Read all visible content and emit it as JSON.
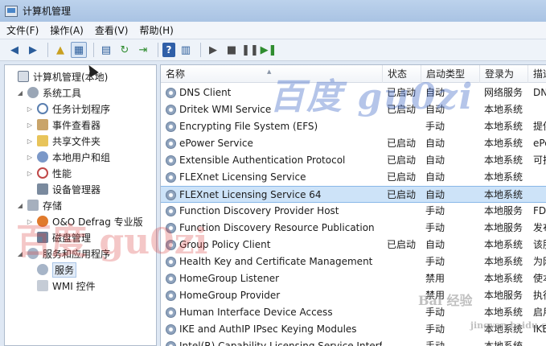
{
  "window": {
    "title": "计算机管理"
  },
  "menu": [
    "文件(F)",
    "操作(A)",
    "查看(V)",
    "帮助(H)"
  ],
  "toolbar": {
    "help_label": "?"
  },
  "tree": [
    {
      "label": "计算机管理(本地)",
      "icon": "computer-icon",
      "level": 0,
      "arrow": ""
    },
    {
      "label": "系统工具",
      "icon": "tools-icon",
      "level": 1,
      "arrow": "◢"
    },
    {
      "label": "任务计划程序",
      "icon": "clock-icon",
      "level": 2,
      "arrow": "▷"
    },
    {
      "label": "事件查看器",
      "icon": "event-viewer-icon",
      "level": 2,
      "arrow": "▷"
    },
    {
      "label": "共享文件夹",
      "icon": "shared-folder-icon",
      "level": 2,
      "arrow": "▷"
    },
    {
      "label": "本地用户和组",
      "icon": "users-icon",
      "level": 2,
      "arrow": "▷"
    },
    {
      "label": "性能",
      "icon": "performance-icon",
      "level": 2,
      "arrow": "▷"
    },
    {
      "label": "设备管理器",
      "icon": "device-manager-icon",
      "level": 2,
      "arrow": ""
    },
    {
      "label": "存储",
      "icon": "storage-icon",
      "level": 1,
      "arrow": "◢"
    },
    {
      "label": "O&O Defrag 专业版",
      "icon": "defrag-icon",
      "level": 2,
      "arrow": "▷"
    },
    {
      "label": "磁盘管理",
      "icon": "disk-icon",
      "level": 2,
      "arrow": ""
    },
    {
      "label": "服务和应用程序",
      "icon": "services-apps-icon",
      "level": 1,
      "arrow": "◢"
    },
    {
      "label": "服务",
      "icon": "services-icon",
      "level": 2,
      "arrow": ""
    },
    {
      "label": "WMI 控件",
      "icon": "wmi-icon",
      "level": 2,
      "arrow": ""
    }
  ],
  "columns": {
    "name": "名称",
    "status": "状态",
    "startup": "启动类型",
    "logon": "登录为",
    "desc": "描述"
  },
  "services": [
    {
      "name": "DNS Client",
      "status": "已启动",
      "startup": "自动",
      "logon": "网络服务",
      "desc": "DN"
    },
    {
      "name": "Dritek WMI Service",
      "status": "已启动",
      "startup": "自动",
      "logon": "本地系统",
      "desc": ""
    },
    {
      "name": "Encrypting File System (EFS)",
      "status": "",
      "startup": "手动",
      "logon": "本地系统",
      "desc": "提供"
    },
    {
      "name": "ePower Service",
      "status": "已启动",
      "startup": "自动",
      "logon": "本地系统",
      "desc": "ePo"
    },
    {
      "name": "Extensible Authentication Protocol",
      "status": "已启动",
      "startup": "自动",
      "logon": "本地系统",
      "desc": "可扩"
    },
    {
      "name": "FLEXnet Licensing Service",
      "status": "已启动",
      "startup": "自动",
      "logon": "本地系统",
      "desc": ""
    },
    {
      "name": "FLEXnet Licensing Service 64",
      "status": "已启动",
      "startup": "自动",
      "logon": "本地系统",
      "desc": ""
    },
    {
      "name": "Function Discovery Provider Host",
      "status": "",
      "startup": "手动",
      "logon": "本地服务",
      "desc": "FD"
    },
    {
      "name": "Function Discovery Resource Publication",
      "status": "",
      "startup": "手动",
      "logon": "本地服务",
      "desc": "发布"
    },
    {
      "name": "Group Policy Client",
      "status": "已启动",
      "startup": "自动",
      "logon": "本地系统",
      "desc": "该服"
    },
    {
      "name": "Health Key and Certificate Management",
      "status": "",
      "startup": "手动",
      "logon": "本地系统",
      "desc": "为网"
    },
    {
      "name": "HomeGroup Listener",
      "status": "",
      "startup": "禁用",
      "logon": "本地系统",
      "desc": "使本"
    },
    {
      "name": "HomeGroup Provider",
      "status": "",
      "startup": "禁用",
      "logon": "本地服务",
      "desc": "执行"
    },
    {
      "name": "Human Interface Device Access",
      "status": "",
      "startup": "手动",
      "logon": "本地系统",
      "desc": "启用"
    },
    {
      "name": "IKE and AuthIP IPsec Keying Modules",
      "status": "",
      "startup": "手动",
      "logon": "本地系统",
      "desc": "IKE"
    },
    {
      "name": "Intel(R) Capability Licensing Service Interf",
      "status": "",
      "startup": "手动",
      "logon": "本地系统",
      "desc": ""
    }
  ],
  "selected_service_index": 6,
  "watermarks": {
    "top": "百度 gu0zi",
    "left": "百度 gu0zi",
    "corner": "Bai 经验",
    "corner_url": "jingyan.baidu.com"
  }
}
